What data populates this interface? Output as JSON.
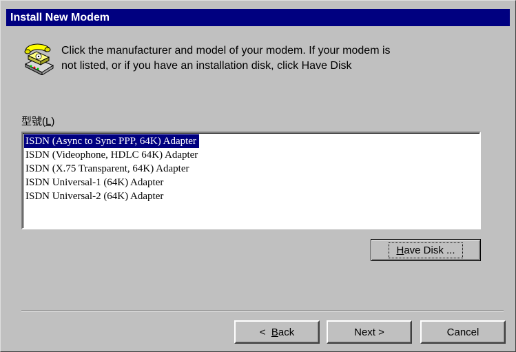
{
  "window": {
    "title": "Install New Modem"
  },
  "intro": {
    "text_line1": "Click the manufacturer and model of your modem. If your modem is",
    "text_line2": "not listed, or if you have an installation disk, click Have Disk",
    "icon": "phone-modem-icon"
  },
  "model_list": {
    "label_prefix": "型號(",
    "label_mnemonic": "L",
    "label_suffix": ")",
    "items": [
      {
        "label": "ISDN (Async to Sync PPP, 64K) Adapter",
        "selected": true
      },
      {
        "label": "ISDN (Videophone, HDLC 64K) Adapter",
        "selected": false
      },
      {
        "label": "ISDN (X.75 Transparent, 64K) Adapter",
        "selected": false
      },
      {
        "label": "ISDN Universal-1 (64K) Adapter",
        "selected": false
      },
      {
        "label": "ISDN Universal-2 (64K) Adapter",
        "selected": false
      }
    ]
  },
  "buttons": {
    "have_disk_mnemonic": "H",
    "have_disk_rest": "ave Disk ...",
    "back_prefix": "< ",
    "back_mnemonic": "B",
    "back_rest": "ack",
    "next_label": "Next >",
    "cancel_label": "Cancel"
  },
  "colors": {
    "face": "#c0c0c0",
    "title_bar": "#000080",
    "selection": "#000080"
  }
}
